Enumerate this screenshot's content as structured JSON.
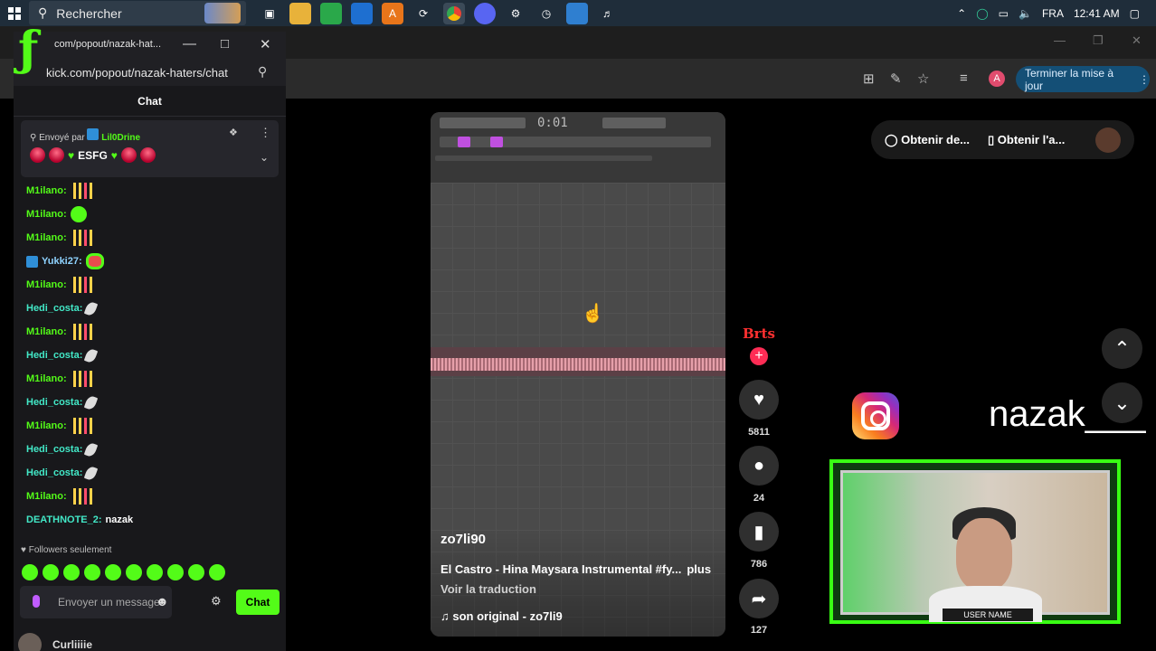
{
  "taskbar": {
    "search_placeholder": "Rechercher",
    "language": "FRA",
    "time": "12:41 AM"
  },
  "browser": {
    "update_button": "Terminer la mise à jour",
    "profile_initial": "A"
  },
  "popout": {
    "title": "com/popout/nazak-hat...",
    "url": "kick.com/popout/nazak-haters/chat",
    "chat_header": "Chat",
    "pinned": {
      "sent_by": "Envoyé par",
      "sender": "Lil0Drine",
      "message": "ESFG"
    },
    "messages": [
      {
        "user": "M1ilano:",
        "emote": "bars"
      },
      {
        "user": "M1ilano:",
        "emote": "blob"
      },
      {
        "user": "M1ilano:",
        "emote": "bars"
      },
      {
        "user": "Yukki27:",
        "emote": "face",
        "badge": true
      },
      {
        "user": "M1ilano:",
        "emote": "bars"
      },
      {
        "user": "Hedi_costa:",
        "emote": "feather"
      },
      {
        "user": "M1ilano:",
        "emote": "bars"
      },
      {
        "user": "Hedi_costa:",
        "emote": "feather"
      },
      {
        "user": "M1ilano:",
        "emote": "bars"
      },
      {
        "user": "Hedi_costa:",
        "emote": "feather"
      },
      {
        "user": "M1ilano:",
        "emote": "bars"
      },
      {
        "user": "Hedi_costa:",
        "emote": "feather"
      },
      {
        "user": "Hedi_costa:",
        "emote": "feather"
      },
      {
        "user": "M1ilano:",
        "emote": "bars"
      },
      {
        "user": "DEATHNOTE_2:",
        "text": "nazak"
      }
    ],
    "followers_only": "Followers seulement",
    "input_placeholder": "Envoyer un message",
    "send_button": "Chat",
    "next_user": "Curliiiie"
  },
  "video": {
    "username": "zo7li90",
    "description": "El Castro - Hina Maysara Instrumental #fy...",
    "more": "plus",
    "translate": "Voir la traduction",
    "sound": "son original - zo7li9",
    "likes": "5811",
    "comments": "24",
    "saves": "786",
    "shares": "127"
  },
  "right": {
    "promo_1": "Obtenir de...",
    "promo_2": "Obtenir l'a...",
    "handle": "nazak___",
    "overlay_label": "USER NAME"
  }
}
